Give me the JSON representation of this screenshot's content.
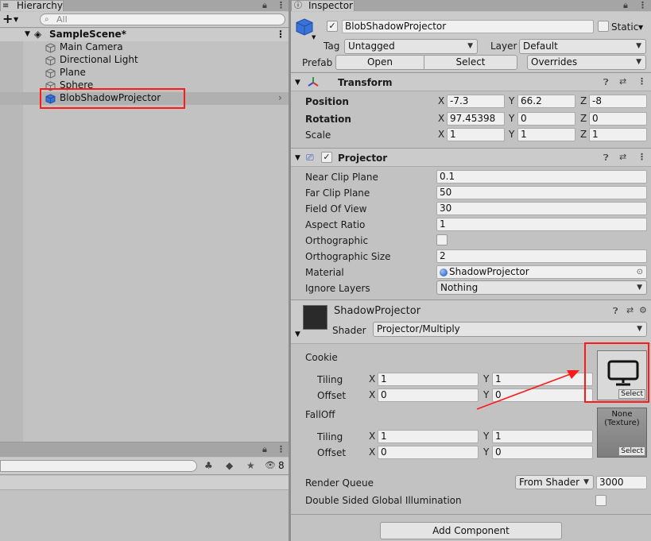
{
  "hierarchy": {
    "tab_label": "Hierarchy",
    "add_label": "+",
    "search_placeholder": "All",
    "scene_name": "SampleScene*",
    "items": [
      "Main Camera",
      "Directional Light",
      "Plane",
      "Sphere",
      "BlobShadowProjector"
    ],
    "selected_index": 4
  },
  "project": {
    "hidden_count": "8"
  },
  "inspector": {
    "tab_label": "Inspector",
    "object_name": "BlobShadowProjector",
    "static_label": "Static",
    "tag_label": "Tag",
    "tag_value": "Untagged",
    "layer_label": "Layer",
    "layer_value": "Default",
    "prefab_label": "Prefab",
    "open_label": "Open",
    "select_label": "Select",
    "overrides_label": "Overrides",
    "transform": {
      "title": "Transform",
      "position_label": "Position",
      "rotation_label": "Rotation",
      "scale_label": "Scale",
      "position": {
        "x": "-7.3",
        "y": "66.2",
        "z": "-8"
      },
      "rotation": {
        "x": "97.45398",
        "y": "0",
        "z": "0"
      },
      "scale": {
        "x": "1",
        "y": "1",
        "z": "1"
      }
    },
    "projector": {
      "title": "Projector",
      "near_clip_label": "Near Clip Plane",
      "near_clip": "0.1",
      "far_clip_label": "Far Clip Plane",
      "far_clip": "50",
      "fov_label": "Field Of View",
      "fov": "30",
      "aspect_label": "Aspect Ratio",
      "aspect": "1",
      "ortho_label": "Orthographic",
      "ortho_size_label": "Orthographic Size",
      "ortho_size": "2",
      "material_label": "Material",
      "material": "ShadowProjector",
      "ignore_layers_label": "Ignore Layers",
      "ignore_layers": "Nothing"
    },
    "material": {
      "name": "ShadowProjector",
      "shader_label": "Shader",
      "shader_value": "Projector/Multiply",
      "cookie_label": "Cookie",
      "falloff_label": "FallOff",
      "tiling_label": "Tiling",
      "offset_label": "Offset",
      "cookie_tiling": {
        "x": "1",
        "y": "1"
      },
      "cookie_offset": {
        "x": "0",
        "y": "0"
      },
      "falloff_tiling": {
        "x": "1",
        "y": "1"
      },
      "falloff_offset": {
        "x": "0",
        "y": "0"
      },
      "texture_select_label": "Select",
      "falloff_none_label": "None\n(Texture)",
      "render_queue_label": "Render Queue",
      "render_queue_mode": "From Shader",
      "render_queue_value": "3000",
      "dsgi_label": "Double Sided Global Illumination"
    },
    "add_component_label": "Add Component"
  },
  "axes": {
    "x": "X",
    "y": "Y",
    "z": "Z"
  },
  "colors": {
    "selection_blue": "#3a72d8",
    "annotation_red": "#ff1a1a",
    "panel_bg": "#c2c2c2",
    "header_bg": "#cbcbcb"
  }
}
